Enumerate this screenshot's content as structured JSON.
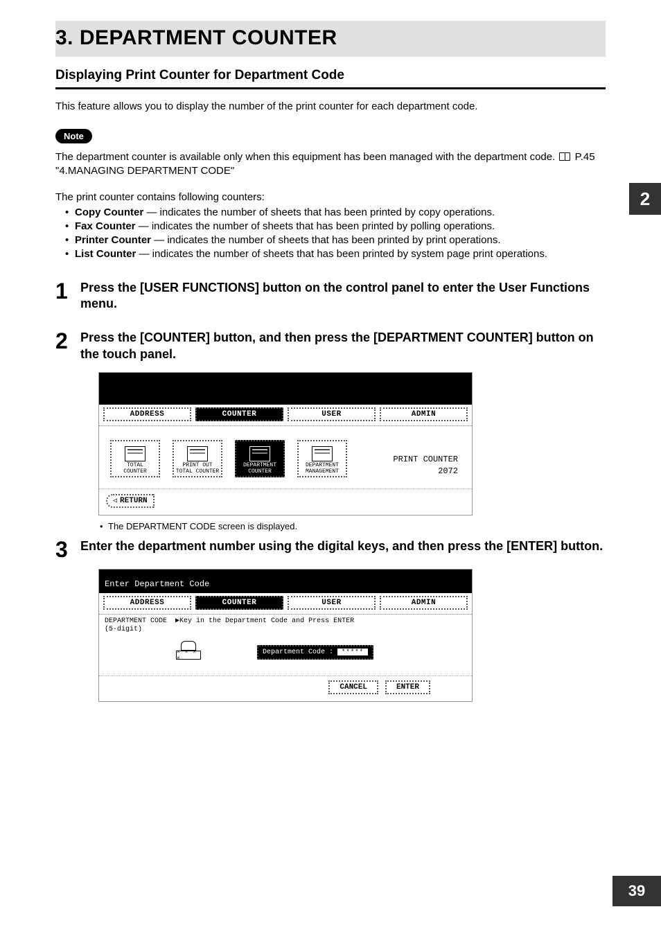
{
  "heading": "3. DEPARTMENT COUNTER",
  "subheading": "Displaying Print Counter for Department Code",
  "intro": "This feature allows you to display the number of the print counter for each department code.",
  "note_label": "Note",
  "note_body_1": "The department counter is available only when this equipment has been managed with the department code.",
  "note_body_2": "P.45 \"4.MANAGING DEPARTMENT CODE\"",
  "counter_para": "The print counter contains following counters:",
  "counters": [
    {
      "name": "Copy Counter",
      "desc": " — indicates the number of sheets that has been printed by copy operations."
    },
    {
      "name": "Fax Counter",
      "desc": " — indicates the number of sheets that has been printed by polling operations."
    },
    {
      "name": "Printer Counter",
      "desc": " — indicates the number of sheets that has been printed by print operations."
    },
    {
      "name": "List Counter",
      "desc": " — indicates the number of sheets that has been printed by system page print operations."
    }
  ],
  "steps": {
    "s1": {
      "num": "1",
      "text": "Press the [USER FUNCTIONS] button on the control panel to enter the User Functions menu."
    },
    "s2": {
      "num": "2",
      "text": "Press the [COUNTER] button, and then press the [DEPARTMENT COUNTER] button on the touch panel.",
      "sub": "The DEPARTMENT CODE screen is displayed."
    },
    "s3": {
      "num": "3",
      "text": "Enter the department number using the digital keys, and then press the [ENTER] button."
    }
  },
  "screen1": {
    "tabs": [
      "ADDRESS",
      "COUNTER",
      "USER",
      "ADMIN"
    ],
    "active_tab": "COUNTER",
    "icons": [
      {
        "l1": "TOTAL",
        "l2": "COUNTER"
      },
      {
        "l1": "PRINT OUT",
        "l2": "TOTAL COUNTER"
      },
      {
        "l1": "DEPARTMENT",
        "l2": "COUNTER",
        "active": true
      },
      {
        "l1": "DEPARTMENT",
        "l2": "MANAGEMENT"
      }
    ],
    "readout_label": "PRINT COUNTER",
    "readout_value": "2072",
    "return": "RETURN"
  },
  "screen2": {
    "title": "Enter Department Code",
    "tabs": [
      "ADDRESS",
      "COUNTER",
      "USER",
      "ADMIN"
    ],
    "active_tab": "COUNTER",
    "hint_l1": "DEPARTMENT CODE  ▶Key in the Department Code and Press ENTER",
    "hint_l2": "(5-digit)",
    "calc_label": "× × × ×",
    "field_label": "Department Code :",
    "field_value": "*****",
    "cancel": "CANCEL",
    "enter": "ENTER"
  },
  "side_tab": "2",
  "page_number": "39"
}
